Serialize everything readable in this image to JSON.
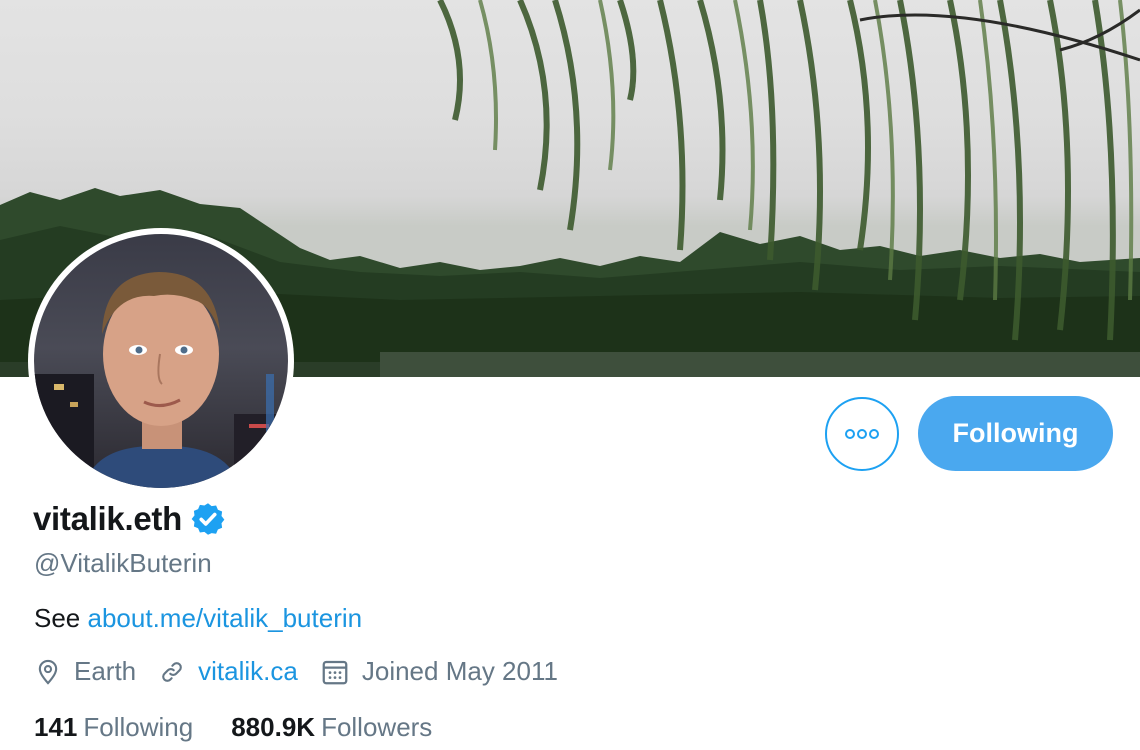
{
  "profile": {
    "display_name": "vitalik.eth",
    "verified": true,
    "handle": "@VitalikButerin",
    "bio_prefix": "See",
    "bio_link": "about.me/vitalik_buterin",
    "location": "Earth",
    "website": "vitalik.ca",
    "joined": "Joined May 2011"
  },
  "actions": {
    "follow_label": "Following",
    "more_icon": "more-horizontal-icon"
  },
  "stats": {
    "following_count": "141",
    "following_label": "Following",
    "followers_count": "880.9K",
    "followers_label": "Followers"
  },
  "colors": {
    "accent": "#1da1f2",
    "follow_button": "#4aa8ef",
    "link": "#1b95e0",
    "secondary_text": "#657786"
  }
}
